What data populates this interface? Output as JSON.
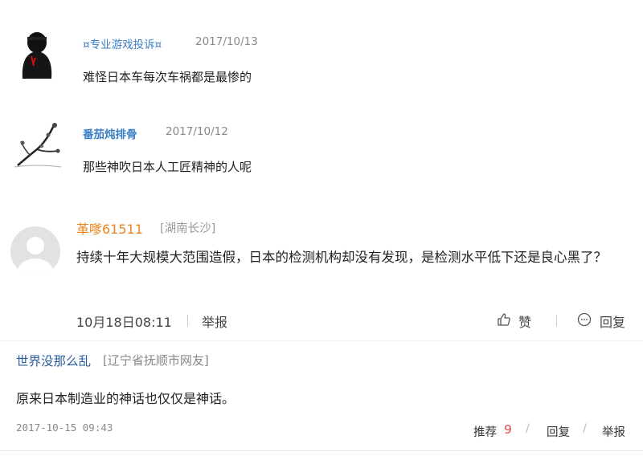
{
  "comments": [
    {
      "username": "¤专业游戏投诉¤",
      "date": "2017/10/13",
      "text": "难怪日本车每次车祸都是最惨的",
      "avatar": "ninja-avatar-icon"
    },
    {
      "username": "番茄炖排骨",
      "date": "2017/10/12",
      "text": "那些神吹日本人工匠精神的人呢",
      "avatar": "plum-blossom-avatar-icon"
    },
    {
      "username": "革嗲61511",
      "location": "[湖南长沙]",
      "text": "持续十年大规模大范围造假，日本的检测机构却没有发现，是检测水平低下还是良心黑了？",
      "time": "10月18日08:11",
      "report_label": "举报",
      "like_label": "赞",
      "reply_label": "回复",
      "avatar": "default-user-avatar-icon"
    },
    {
      "username": "世界没那么乱",
      "location": "[辽宁省抚顺市网友]",
      "text": "原来日本制造业的神话也仅仅是神话。",
      "time": "2017-10-15 09:43",
      "recommend_label": "推荐",
      "recommend_count": "9",
      "separator": "/",
      "reply_label": "回复",
      "report_label": "举报"
    }
  ],
  "colors": {
    "username_blue": "#3a7fc4",
    "username_orange": "#e8851c",
    "username_darkblue": "#2b5c9e",
    "count_red": "#e24a4a",
    "date_gray": "#888888"
  }
}
